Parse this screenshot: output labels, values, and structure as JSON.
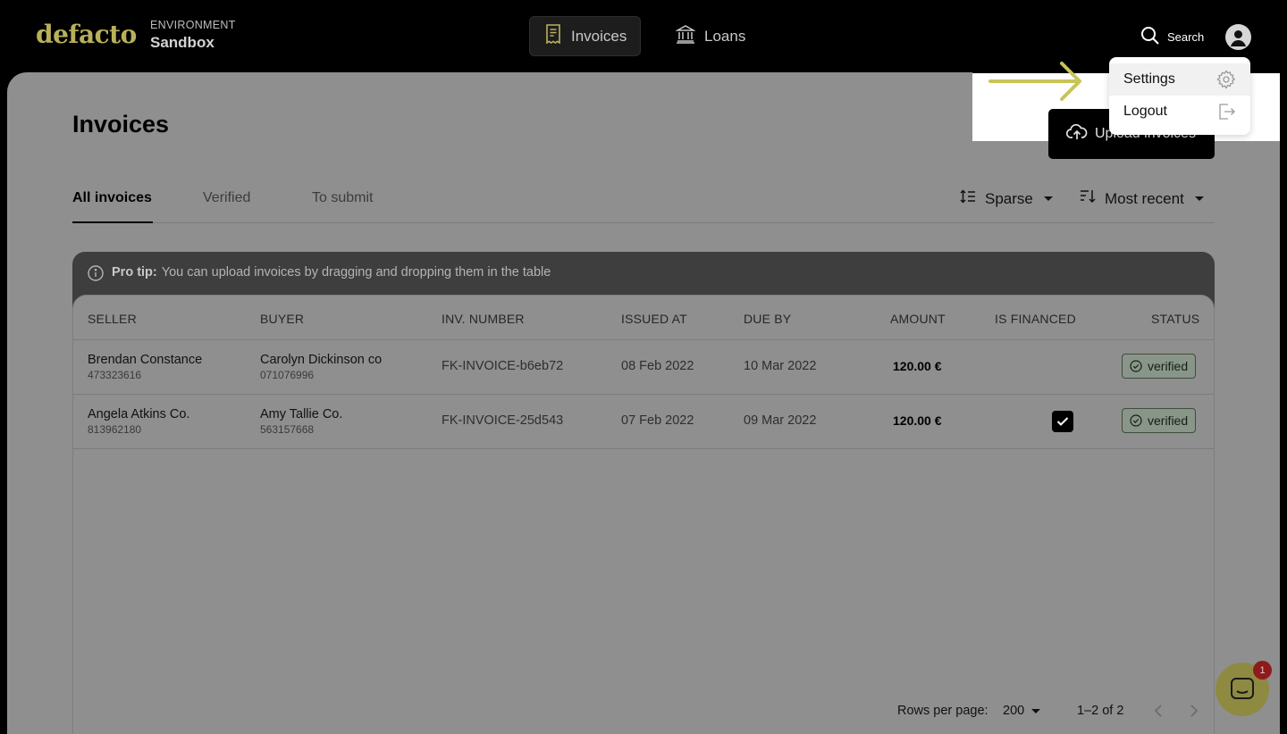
{
  "brand": {
    "logo": "defacto",
    "accent": "#b9b15a"
  },
  "environment": {
    "label": "ENVIRONMENT",
    "value": "Sandbox"
  },
  "nav": [
    {
      "label": "Invoices",
      "icon": "receipt-icon",
      "active": true
    },
    {
      "label": "Loans",
      "icon": "bank-icon",
      "active": false
    }
  ],
  "search": {
    "label": "Search"
  },
  "user_menu": {
    "items": [
      {
        "label": "Settings",
        "icon": "gear-icon"
      },
      {
        "label": "Logout",
        "icon": "logout-icon"
      }
    ]
  },
  "page": {
    "title": "Invoices",
    "upload_label": "Upload invoices"
  },
  "tabs": [
    {
      "label": "All invoices",
      "active": true
    },
    {
      "label": "Verified",
      "active": false
    },
    {
      "label": "To submit",
      "active": false
    }
  ],
  "controls": {
    "density": "Sparse",
    "sort": "Most recent"
  },
  "tip": {
    "label": "Pro tip:",
    "text": "You can upload invoices by dragging and dropping them in the table"
  },
  "table": {
    "columns": [
      "SELLER",
      "BUYER",
      "INV. NUMBER",
      "ISSUED AT",
      "DUE BY",
      "AMOUNT",
      "IS FINANCED",
      "STATUS"
    ],
    "rows": [
      {
        "seller": "Brendan Constance",
        "seller_id": "473323616",
        "buyer": "Carolyn Dickinson co",
        "buyer_id": "071076996",
        "invoice": "FK-INVOICE-b6eb72",
        "issued": "08 Feb 2022",
        "due": "10 Mar 2022",
        "amount": "120.00 €",
        "financed": false,
        "status": "verified"
      },
      {
        "seller": "Angela Atkins Co.",
        "seller_id": "813962180",
        "buyer": "Amy Tallie Co.",
        "buyer_id": "563157668",
        "invoice": "FK-INVOICE-25d543",
        "issued": "07 Feb 2022",
        "due": "09 Mar 2022",
        "amount": "120.00 €",
        "financed": true,
        "status": "verified"
      }
    ]
  },
  "pagination": {
    "rows_label": "Rows per page:",
    "rows_value": "200",
    "range": "1–2 of 2"
  },
  "chat": {
    "unread": "1"
  }
}
